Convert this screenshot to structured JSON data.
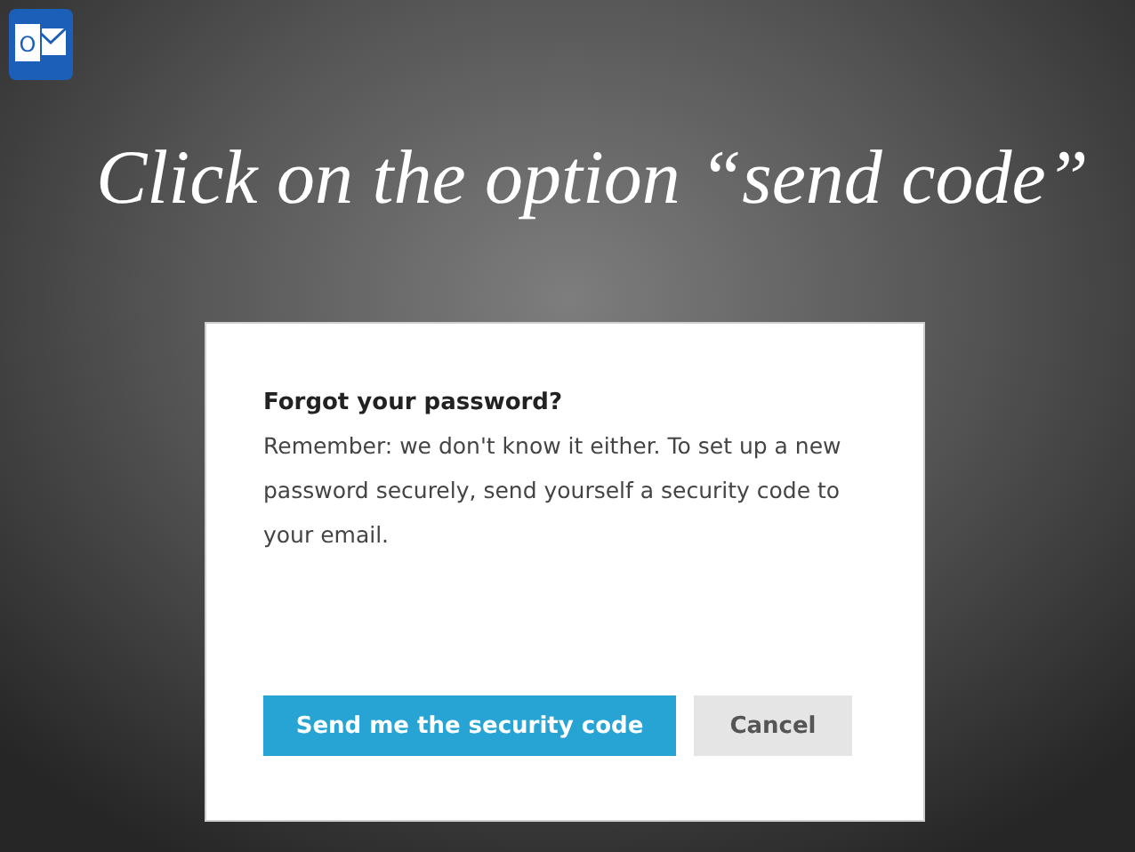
{
  "app_icon": {
    "letter": "O"
  },
  "slide": {
    "title": "Click on the option “send code”"
  },
  "dialog": {
    "heading": "Forgot your password?",
    "body": "Remember: we don't know it either. To set up a new password securely, send yourself a security code to your email.",
    "buttons": [
      {
        "label": "Send me the security code",
        "kind": "primary"
      },
      {
        "label": "Cancel",
        "kind": "secondary"
      }
    ]
  }
}
